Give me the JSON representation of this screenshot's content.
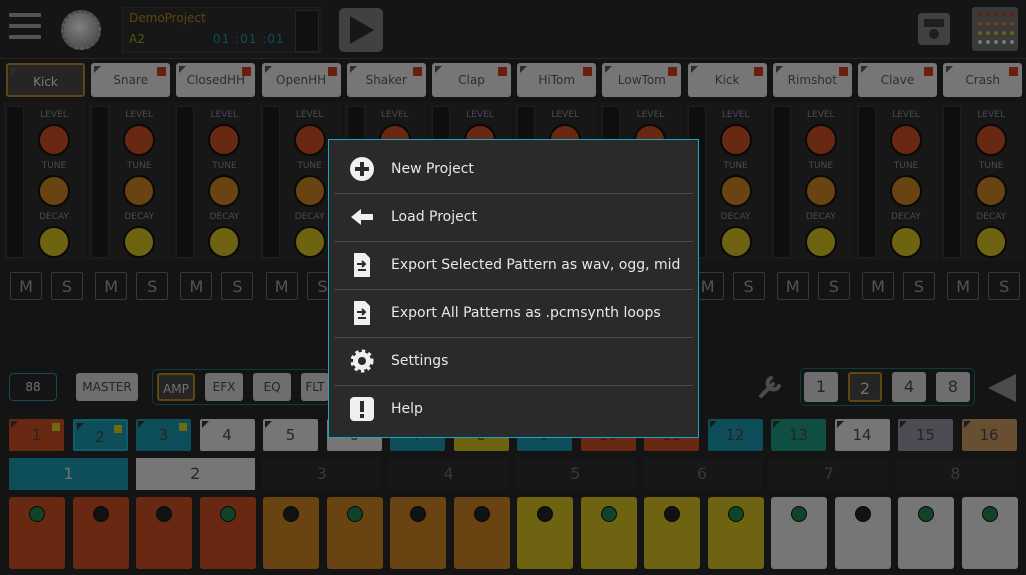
{
  "header": {
    "project_name": "DemoProject",
    "note": "A2",
    "position": "01 :01 :01"
  },
  "instruments": [
    "Kick",
    "Snare",
    "ClosedHH",
    "OpenHH",
    "Shaker",
    "Clap",
    "HiTom",
    "LowTom",
    "Kick",
    "Rimshot",
    "Clave",
    "Crash"
  ],
  "knob_labels": {
    "level": "LEVEL",
    "tune": "TUNE",
    "decay": "DECAY"
  },
  "mute_label": "M",
  "solo_label": "S",
  "controls": {
    "bpm": "88",
    "master": "MASTER",
    "tabs": [
      "AMP",
      "EFX",
      "EQ",
      "FLT"
    ],
    "zoom": [
      "1",
      "2",
      "4",
      "8"
    ],
    "zoom_selected": "2"
  },
  "patterns": [
    "1",
    "2",
    "3",
    "4",
    "5",
    "6",
    "7",
    "8",
    "9",
    "10",
    "11",
    "12",
    "13",
    "14",
    "15",
    "16"
  ],
  "pages": [
    "1",
    "2",
    "3",
    "4",
    "5",
    "6",
    "7",
    "8"
  ],
  "menu": {
    "items": [
      {
        "label": "New Project",
        "icon": "plus-circle-icon"
      },
      {
        "label": "Load Project",
        "icon": "arrow-left-icon"
      },
      {
        "label": "Export Selected Pattern as wav, ogg, mid",
        "icon": "export-file-icon"
      },
      {
        "label": "Export All Patterns as .pcmsynth loops",
        "icon": "export-file-icon"
      },
      {
        "label": "Settings",
        "icon": "gear-icon"
      },
      {
        "label": "Help",
        "icon": "exclamation-icon"
      }
    ]
  },
  "colors": {
    "accent": "#1aa6c0",
    "red": "#c04a22",
    "orange": "#c07c22",
    "yellow": "#c8b420",
    "teal": "#1a8fa5"
  }
}
